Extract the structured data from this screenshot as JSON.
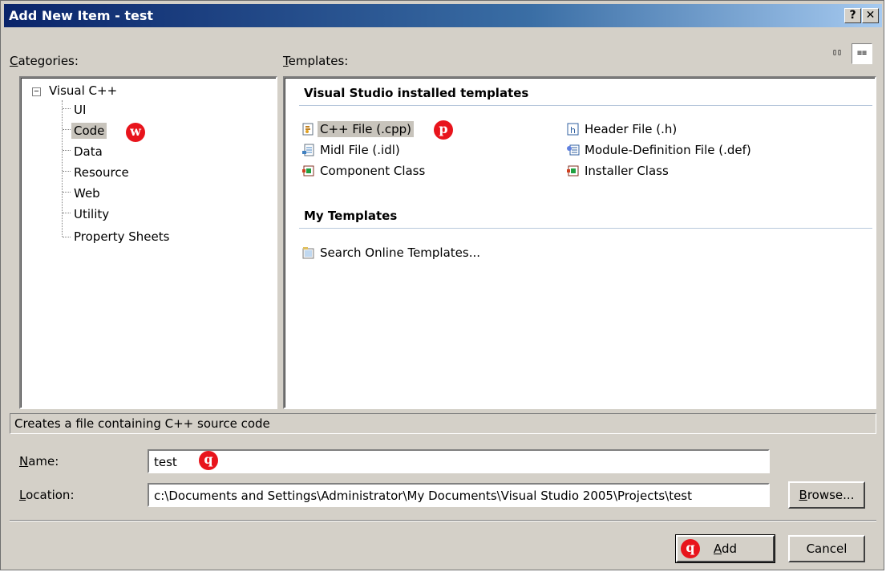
{
  "window": {
    "title": "Add New Item - test",
    "help_label": "?",
    "close_label": "✕"
  },
  "categories": {
    "label_prefix": "C",
    "label_rest": "ategories:",
    "root": {
      "expander": "−",
      "label": "Visual C++"
    },
    "items": [
      {
        "label": "UI",
        "selected": false
      },
      {
        "label": "Code",
        "selected": true
      },
      {
        "label": "Data",
        "selected": false
      },
      {
        "label": "Resource",
        "selected": false
      },
      {
        "label": "Web",
        "selected": false
      },
      {
        "label": "Utility",
        "selected": false
      },
      {
        "label": "Property Sheets",
        "selected": false
      }
    ]
  },
  "templates": {
    "label_prefix": "T",
    "label_rest": "emplates:",
    "view_large_icons": "▯▯",
    "view_small_icons": "≡≡",
    "installed_header": "Visual Studio installed templates",
    "installed": [
      {
        "label": "C++ File (.cpp)",
        "icon": "cpp-file-icon",
        "selected": true
      },
      {
        "label": "Header File (.h)",
        "icon": "header-file-icon",
        "selected": false
      },
      {
        "label": "Midl File (.idl)",
        "icon": "midl-file-icon",
        "selected": false
      },
      {
        "label": "Module-Definition File (.def)",
        "icon": "module-definition-icon",
        "selected": false
      },
      {
        "label": "Component Class",
        "icon": "component-class-icon",
        "selected": false
      },
      {
        "label": "Installer Class",
        "icon": "installer-class-icon",
        "selected": false
      }
    ],
    "my_header": "My Templates",
    "my": [
      {
        "label": "Search Online Templates...",
        "icon": "search-online-icon"
      }
    ]
  },
  "description": "Creates a file containing C++ source code",
  "name_field": {
    "label_prefix": "N",
    "label_rest": "ame:",
    "value": "test"
  },
  "location_field": {
    "label_prefix": "L",
    "label_rest": "ocation:",
    "value": "c:\\Documents and Settings\\Administrator\\My Documents\\Visual Studio 2005\\Projects\\test"
  },
  "buttons": {
    "browse_prefix": "B",
    "browse_rest": "rowse...",
    "add_prefix": "A",
    "add_rest": "dd",
    "cancel": "Cancel"
  },
  "markers": {
    "code": "w",
    "cpp": "p",
    "name": "q",
    "add": "q"
  },
  "colors": {
    "title_start": "#0a246a",
    "title_end": "#a6caf0",
    "dialog_bg": "#d4d0c8",
    "marker": "#e8141c",
    "selection": "#c8c4bc"
  }
}
